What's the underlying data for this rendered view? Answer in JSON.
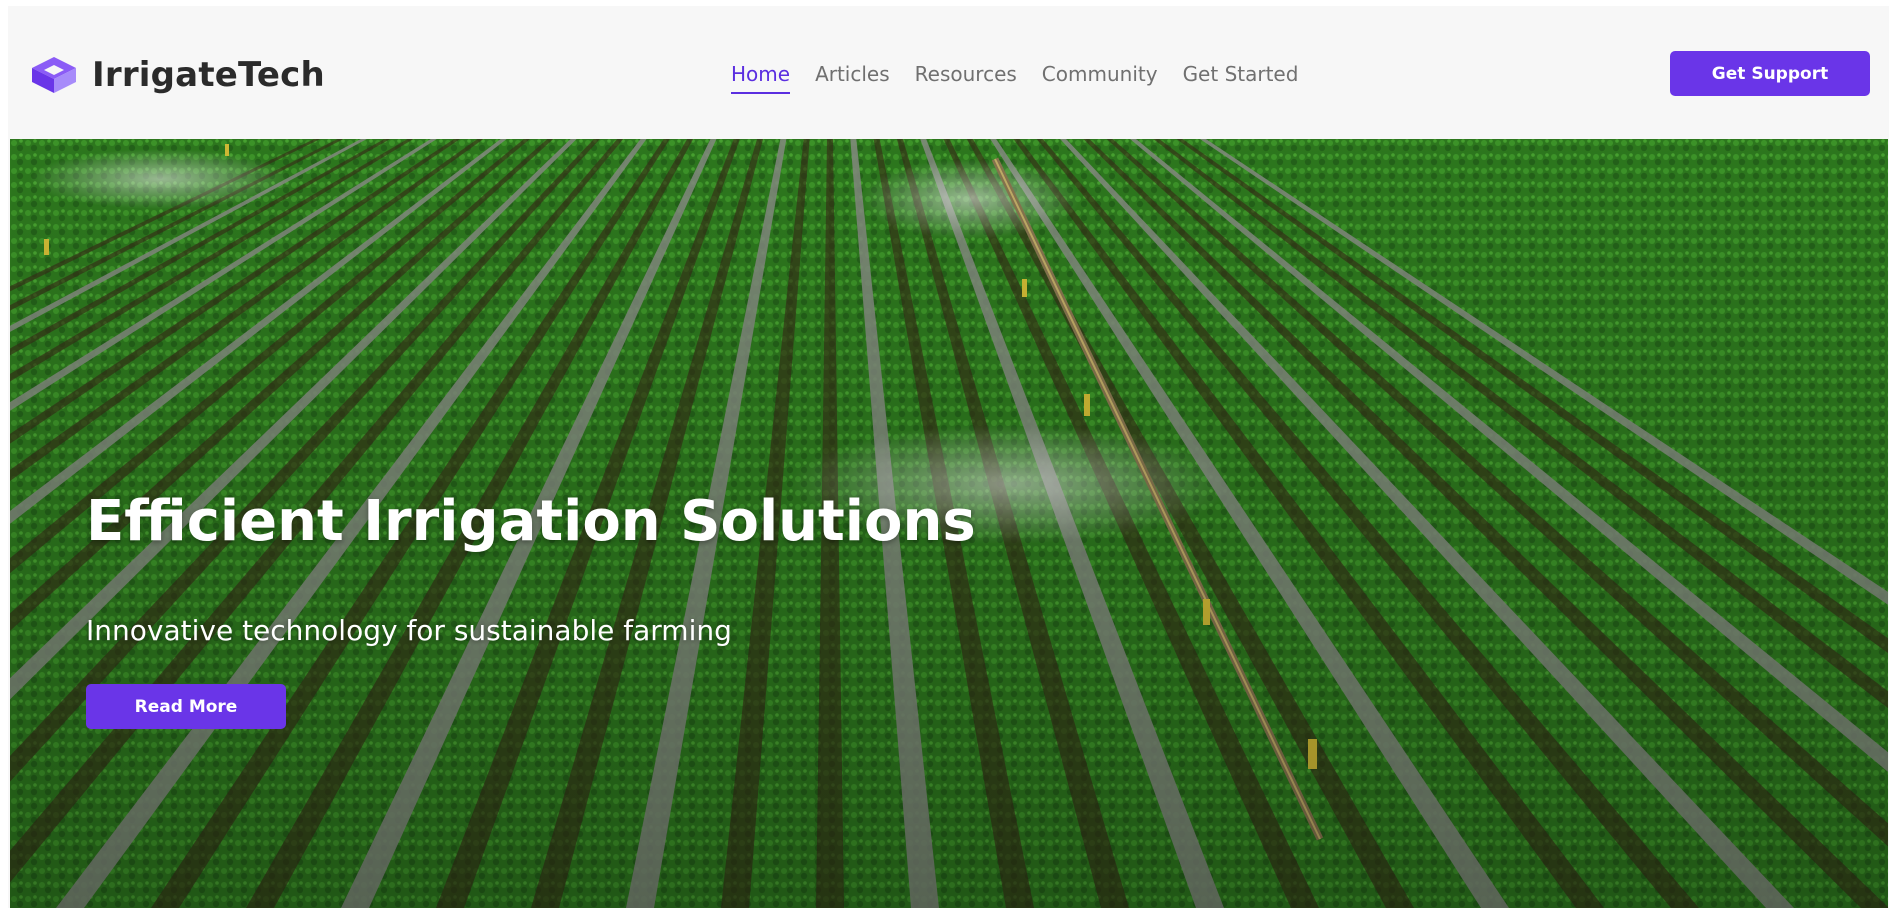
{
  "brand": {
    "name": "IrrigateTech",
    "logo_icon": "cube-logo-icon",
    "accent_color": "#6a35e8"
  },
  "nav": {
    "items": [
      {
        "label": "Home",
        "active": true
      },
      {
        "label": "Articles",
        "active": false
      },
      {
        "label": "Resources",
        "active": false
      },
      {
        "label": "Community",
        "active": false
      },
      {
        "label": "Get Started",
        "active": false
      }
    ]
  },
  "header": {
    "support_label": "Get Support"
  },
  "hero": {
    "background": "irrigated-crop-field-photo",
    "title": "Efficient Irrigation Solutions",
    "subtitle": "Innovative technology for sustainable farming",
    "cta_label": "Read More"
  }
}
